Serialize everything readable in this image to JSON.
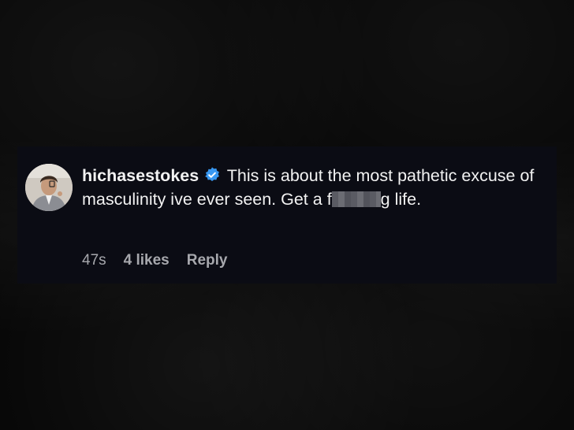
{
  "comment": {
    "username": "hichasestokes",
    "verified_icon": "verified-badge-icon",
    "text_start": "This is about the most pathetic excuse of masculinity ive ever seen. Get a f",
    "text_end": "g life.",
    "timestamp": "47s",
    "likes": "4 likes",
    "reply_label": "Reply"
  },
  "colors": {
    "background": "#070707",
    "card": "#0b0c14",
    "text": "#f2f2f2",
    "meta": "#a7a8ad",
    "verified": "#3897f0"
  }
}
